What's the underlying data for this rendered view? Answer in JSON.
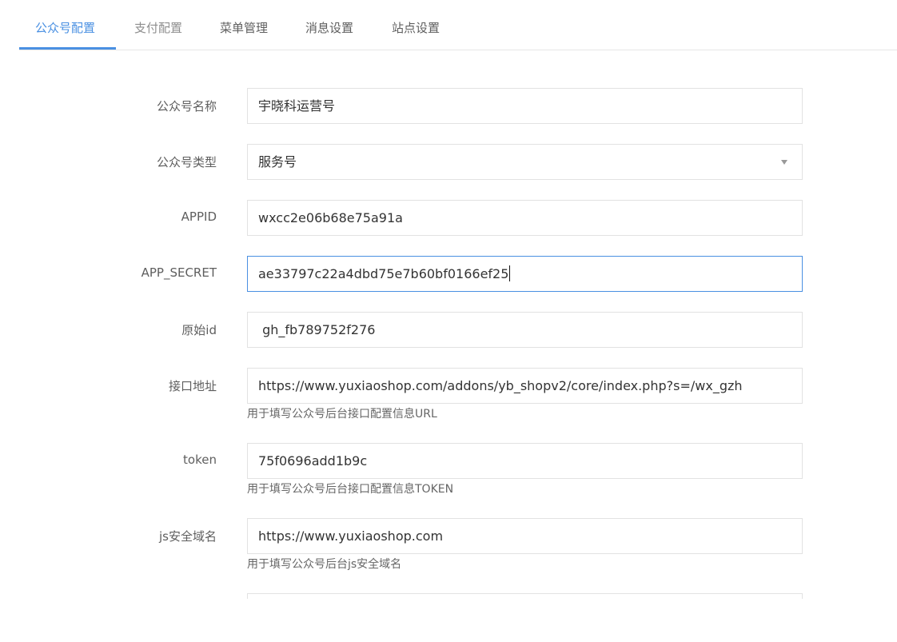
{
  "tabs": [
    {
      "label": "公众号配置",
      "active": true
    },
    {
      "label": "支付配置",
      "active": false
    },
    {
      "label": "菜单管理",
      "active": false
    },
    {
      "label": "消息设置",
      "active": false
    },
    {
      "label": "站点设置",
      "active": false
    }
  ],
  "form": {
    "name": {
      "label": "公众号名称",
      "value": "宇晓科运营号"
    },
    "type": {
      "label": "公众号类型",
      "value": "服务号"
    },
    "appid": {
      "label": "APPID",
      "value": "wxcc2e06b68e75a91a"
    },
    "secret": {
      "label": "APP_SECRET",
      "value": "ae33797c22a4dbd75e7b60bf0166ef25"
    },
    "origin_id": {
      "label": "原始id",
      "value": " gh_fb789752f276"
    },
    "api_url": {
      "label": "接口地址",
      "value": "https://www.yuxiaoshop.com/addons/yb_shopv2/core/index.php?s=/wx_gzh",
      "hint": "用于填写公众号后台接口配置信息URL"
    },
    "token": {
      "label": "token",
      "value": "75f0696add1b9c",
      "hint": "用于填写公众号后台接口配置信息TOKEN"
    },
    "js_domain": {
      "label": "js安全域名",
      "value": "https://www.yuxiaoshop.com",
      "hint": "用于填写公众号后台js安全域名"
    }
  },
  "colors": {
    "accent": "#4a90e2",
    "border": "#e2e2e2",
    "text": "#333333",
    "muted": "#8e8e8e"
  }
}
